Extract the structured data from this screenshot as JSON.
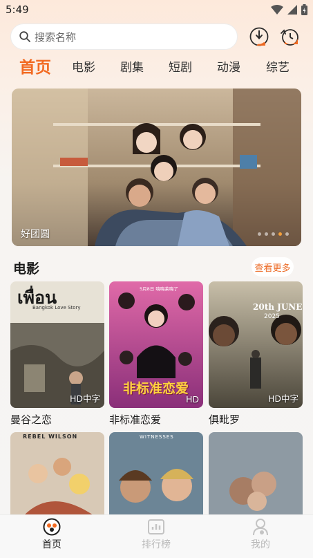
{
  "status_bar": {
    "time": "5:49"
  },
  "search": {
    "placeholder": "搜索名称"
  },
  "tabs": [
    "首页",
    "电影",
    "剧集",
    "短剧",
    "动漫",
    "综艺"
  ],
  "banner": {
    "title": "好团圆",
    "dot_count": 5
  },
  "section": {
    "title": "电影",
    "more_label": "查看更多"
  },
  "movies": [
    {
      "title": "曼谷之恋",
      "badge": "HD中字",
      "poster_text": "เพื่อน",
      "poster_subtext": "Bangkok Love Story"
    },
    {
      "title": "非标准恋爱",
      "badge": "HD",
      "poster_text": "非标准恋爱",
      "poster_subtext": "5月8日 嗨嗨莱嗨了"
    },
    {
      "title": "俱毗罗",
      "badge": "HD中字",
      "poster_text": "20th JUNE",
      "poster_subtext": "2025"
    }
  ],
  "movies_row2": [
    {
      "poster_text": "REBEL WILSON"
    },
    {
      "poster_text": "WITNESSES"
    },
    {
      "poster_text": ""
    }
  ],
  "bottom_nav": [
    {
      "label": "首页",
      "active": true
    },
    {
      "label": "排行榜",
      "active": false
    },
    {
      "label": "我的",
      "active": false
    }
  ],
  "colors": {
    "accent": "#f26a21",
    "inactive": "#b9b9b9"
  }
}
